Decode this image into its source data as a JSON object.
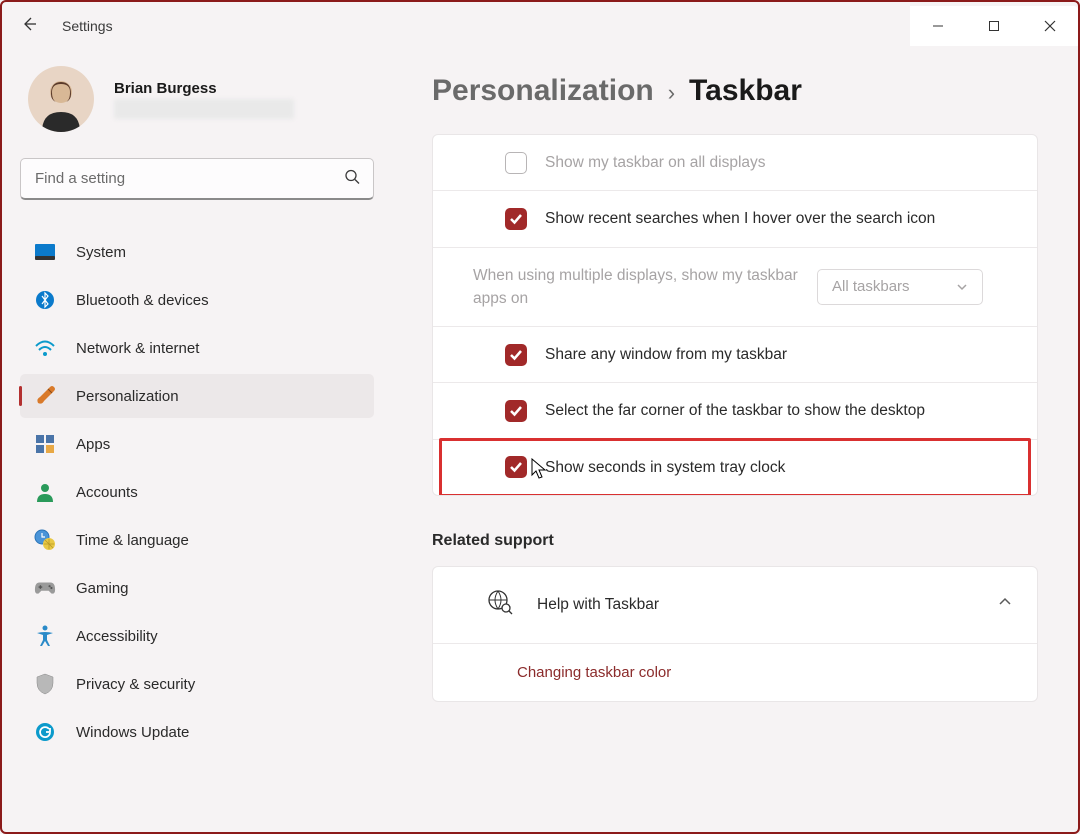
{
  "title": "Settings",
  "user": {
    "name": "Brian Burgess"
  },
  "search": {
    "placeholder": "Find a setting"
  },
  "nav": [
    {
      "label": "System"
    },
    {
      "label": "Bluetooth & devices"
    },
    {
      "label": "Network & internet"
    },
    {
      "label": "Personalization"
    },
    {
      "label": "Apps"
    },
    {
      "label": "Accounts"
    },
    {
      "label": "Time & language"
    },
    {
      "label": "Gaming"
    },
    {
      "label": "Accessibility"
    },
    {
      "label": "Privacy & security"
    },
    {
      "label": "Windows Update"
    }
  ],
  "breadcrumb": {
    "parent": "Personalization",
    "current": "Taskbar"
  },
  "settings": {
    "show_all_displays": "Show my taskbar on all displays",
    "recent_searches": "Show recent searches when I hover over the search icon",
    "multi_display_label": "When using multiple displays, show my taskbar apps on",
    "multi_display_value": "All taskbars",
    "share_window": "Share any window from my taskbar",
    "far_corner": "Select the far corner of the taskbar to show the desktop",
    "show_seconds": "Show seconds in system tray clock"
  },
  "related": {
    "heading": "Related support",
    "help_title": "Help with Taskbar",
    "link1": "Changing taskbar color"
  }
}
